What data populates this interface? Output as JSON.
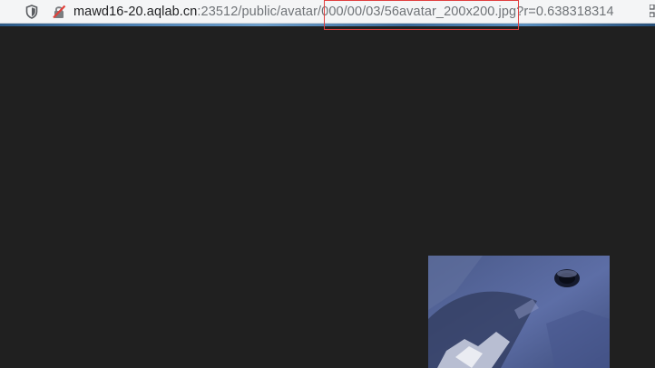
{
  "browser": {
    "address_bar": {
      "url_host_prefix": "mawd16-20.",
      "url_host_main": "aqlab.cn",
      "url_port_path": ":23512/public/avatar/",
      "url_highlighted": "000/00/03/56avatar_200x200.jpg",
      "url_tail": "?r=0.638318314"
    },
    "icons": {
      "shield": "shield-icon",
      "insecure": "insecure-connection-icon",
      "qr": "qr-code-icon"
    },
    "accent_colors": {
      "highlight_border": "#e04040",
      "background": "#202020"
    }
  },
  "content": {
    "image": "avatar-image"
  }
}
